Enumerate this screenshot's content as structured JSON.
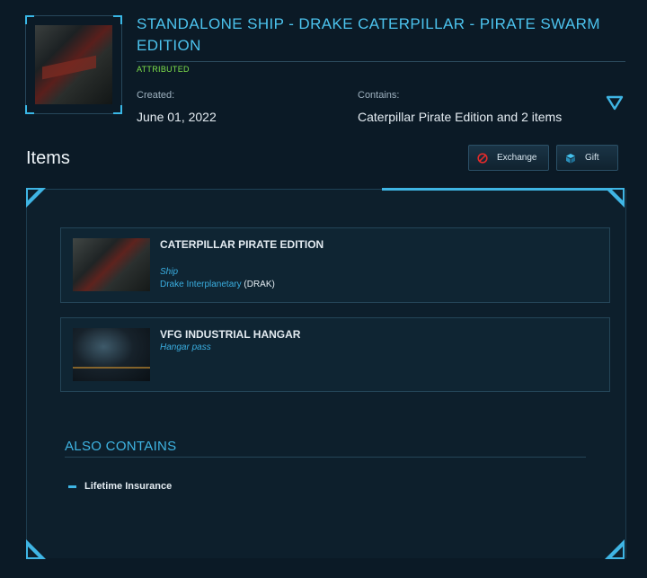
{
  "package": {
    "title": "STANDALONE SHIP - DRAKE CATERPILLAR - PIRATE SWARM EDITION",
    "badge": "ATTRIBUTED",
    "created_label": "Created:",
    "created_value": "June 01, 2022",
    "contains_label": "Contains:",
    "contains_value": "Caterpillar Pirate Edition and 2 items"
  },
  "items_section": {
    "heading": "Items",
    "exchange_label": "Exchange",
    "gift_label": "Gift"
  },
  "items": [
    {
      "name": "CATERPILLAR PIRATE EDITION",
      "type": "Ship",
      "manufacturer": "Drake Interplanetary",
      "manufacturer_code": "(DRAK)"
    },
    {
      "name": "VFG INDUSTRIAL HANGAR",
      "type": "Hangar pass"
    }
  ],
  "also_contains": {
    "heading": "ALSO CONTAINS",
    "entries": [
      "Lifetime Insurance"
    ]
  },
  "colors": {
    "accent": "#3fb5e4",
    "badge": "#7ee04a",
    "background": "#0b1a26",
    "exchange_icon": "#e02b2b",
    "gift_icon": "#45c3ef"
  },
  "icons": {
    "toggle": "triangle-down-icon",
    "exchange": "no-entry-icon",
    "gift": "cube-icon"
  }
}
